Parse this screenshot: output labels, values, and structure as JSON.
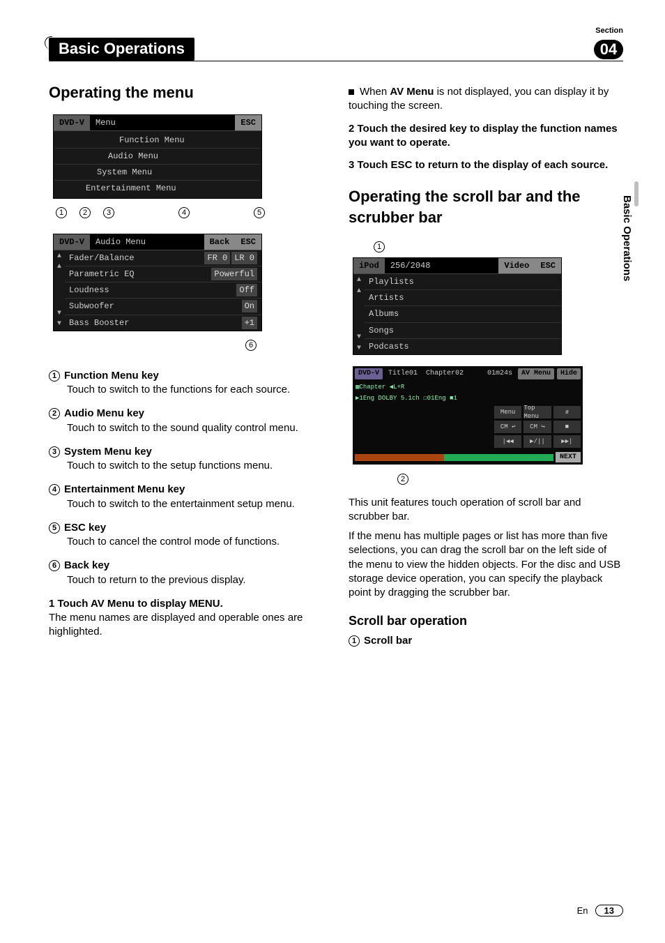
{
  "header": {
    "section_label": "Section",
    "title": "Basic Operations",
    "number": "04"
  },
  "side_tab": "Basic Operations",
  "left": {
    "h2": "Operating the menu",
    "menu_panel": {
      "src": "DVD-V",
      "tab": "Menu",
      "esc": "ESC",
      "items": [
        "Function Menu",
        "Audio Menu",
        "System Menu",
        "Entertainment Menu"
      ],
      "callouts": [
        "1",
        "2",
        "3",
        "4",
        "5"
      ]
    },
    "audio_panel": {
      "src": "DVD-V",
      "title": "Audio Menu",
      "back": "Back",
      "esc": "ESC",
      "rows": [
        {
          "label": "Fader/Balance",
          "vals": [
            "FR 0",
            "LR 0"
          ]
        },
        {
          "label": "Parametric EQ",
          "vals": [
            "Powerful"
          ]
        },
        {
          "label": "Loudness",
          "vals": [
            "Off"
          ]
        },
        {
          "label": "Subwoofer",
          "vals": [
            "On"
          ]
        },
        {
          "label": "Bass Booster",
          "vals": [
            "+1"
          ]
        }
      ],
      "callout": "6"
    },
    "terms": [
      {
        "n": "1",
        "title": "Function Menu key",
        "body": "Touch to switch to the functions for each source."
      },
      {
        "n": "2",
        "title": "Audio Menu key",
        "body": "Touch to switch to the sound quality control menu."
      },
      {
        "n": "3",
        "title": "System Menu key",
        "body": "Touch to switch to the setup functions menu."
      },
      {
        "n": "4",
        "title": "Entertainment Menu key",
        "body": "Touch to switch to the entertainment setup menu."
      },
      {
        "n": "5",
        "title": "ESC key",
        "body": "Touch to cancel the control mode of functions."
      },
      {
        "n": "6",
        "title": "Back key",
        "body": "Touch to return to the previous display."
      }
    ],
    "step1_head": "1   Touch AV Menu to display MENU.",
    "step1_body": "The menu names are displayed and operable ones are highlighted."
  },
  "right": {
    "bullet_pre": "When ",
    "bullet_bold": "AV Menu",
    "bullet_post": " is not displayed, you can display it by touching the screen.",
    "step2": "2   Touch the desired key to display the function names you want to operate.",
    "step3": "3   Touch ESC to return to the display of each source.",
    "h2": "Operating the scroll bar and the scrubber bar",
    "ipod_panel": {
      "callout": "1",
      "src": "iPod",
      "counter": "256/2048",
      "video": "Video",
      "esc": "ESC",
      "items": [
        "Playlists",
        "Artists",
        "Albums",
        "Songs",
        "Podcasts"
      ]
    },
    "dvd_panel": {
      "src": "DVD-V",
      "title": "Title01",
      "chapter": "Chapter02",
      "time": "01m24s",
      "avmenu": "AV Menu",
      "hide": "Hide",
      "line2": "▶1Eng DOLBY 5.1ch ☐01Eng ■1",
      "chap_line": "▦Chapter  ◀L+R",
      "btns_row1": [
        "Menu",
        "Top Menu",
        "⇵"
      ],
      "btns_row2": [
        "CM ↩",
        "CM ↪",
        "■"
      ],
      "btns_row3": [
        "|◀◀",
        "▶/||",
        "▶▶|"
      ],
      "next": "NEXT",
      "callout": "2"
    },
    "para1": "This unit features touch operation of scroll bar and scrubber bar.",
    "para2": "If the menu has multiple pages or list has more than five selections, you can drag the scroll bar on the left side of the menu to view the hidden objects. For the disc and USB storage device operation, you can specify the playback point by dragging the scrubber bar.",
    "h3": "Scroll bar operation",
    "scroll_item": {
      "n": "1",
      "title": "Scroll bar"
    }
  },
  "footer": {
    "lang": "En",
    "page": "13"
  }
}
